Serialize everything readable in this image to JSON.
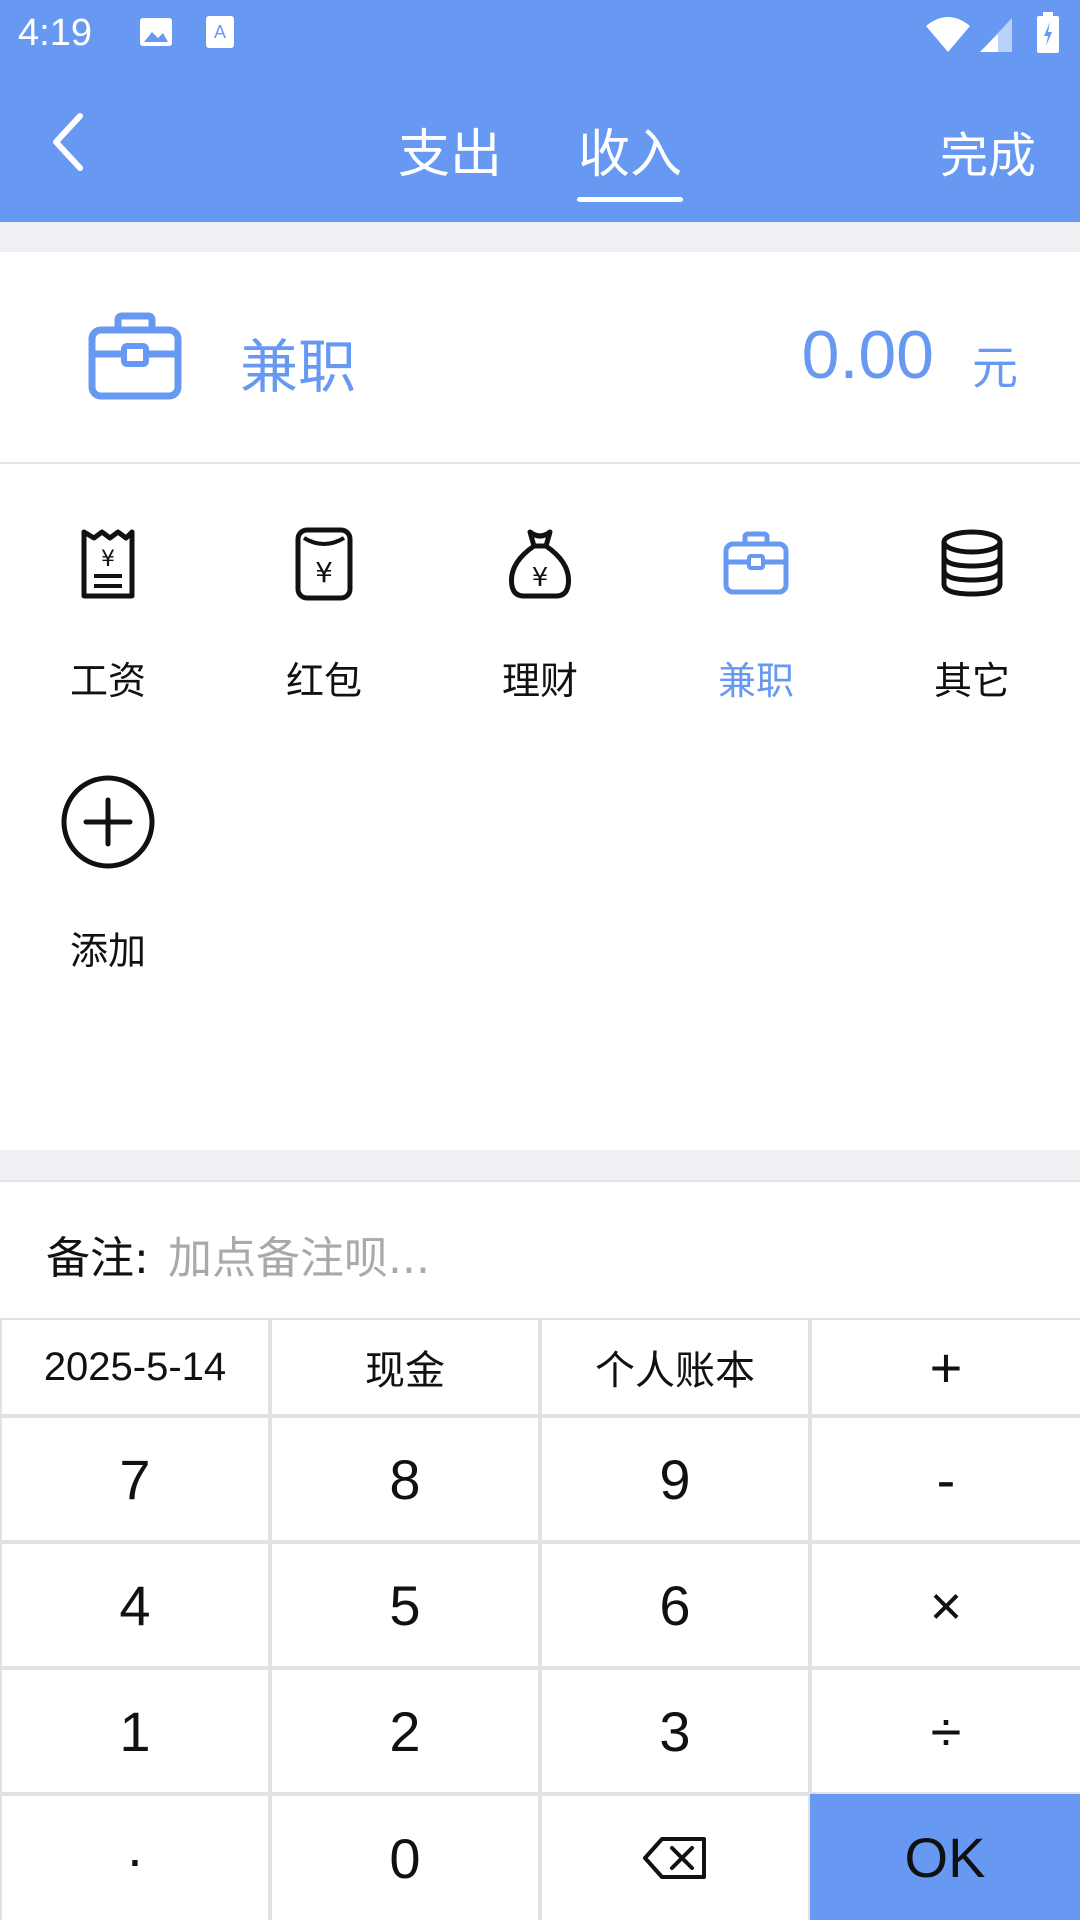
{
  "status_bar": {
    "time": "4:19"
  },
  "header": {
    "tabs": [
      {
        "label": "支出"
      },
      {
        "label": "收入"
      }
    ],
    "done_label": "完成",
    "accent_color": "#6799f2"
  },
  "amount": {
    "category": "兼职",
    "value": "0.00",
    "unit": "元"
  },
  "categories": [
    {
      "label": "工资",
      "icon": "payslip-icon"
    },
    {
      "label": "红包",
      "icon": "red-envelope-icon"
    },
    {
      "label": "理财",
      "icon": "money-bag-icon"
    },
    {
      "label": "兼职",
      "icon": "briefcase-icon",
      "selected": true
    },
    {
      "label": "其它",
      "icon": "coin-stack-icon"
    },
    {
      "label": "添加",
      "icon": "add-circle-icon"
    }
  ],
  "remark": {
    "label": "备注:",
    "placeholder": "加点备注呗..."
  },
  "keypad": {
    "date": "2025-5-14",
    "account": "现金",
    "book": "个人账本",
    "keys": {
      "plus": "+",
      "minus": "-",
      "multiply": "×",
      "divide": "÷",
      "seven": "7",
      "eight": "8",
      "nine": "9",
      "four": "4",
      "five": "5",
      "six": "6",
      "one": "1",
      "two": "2",
      "three": "3",
      "dot": "·",
      "zero": "0",
      "ok": "OK"
    }
  }
}
